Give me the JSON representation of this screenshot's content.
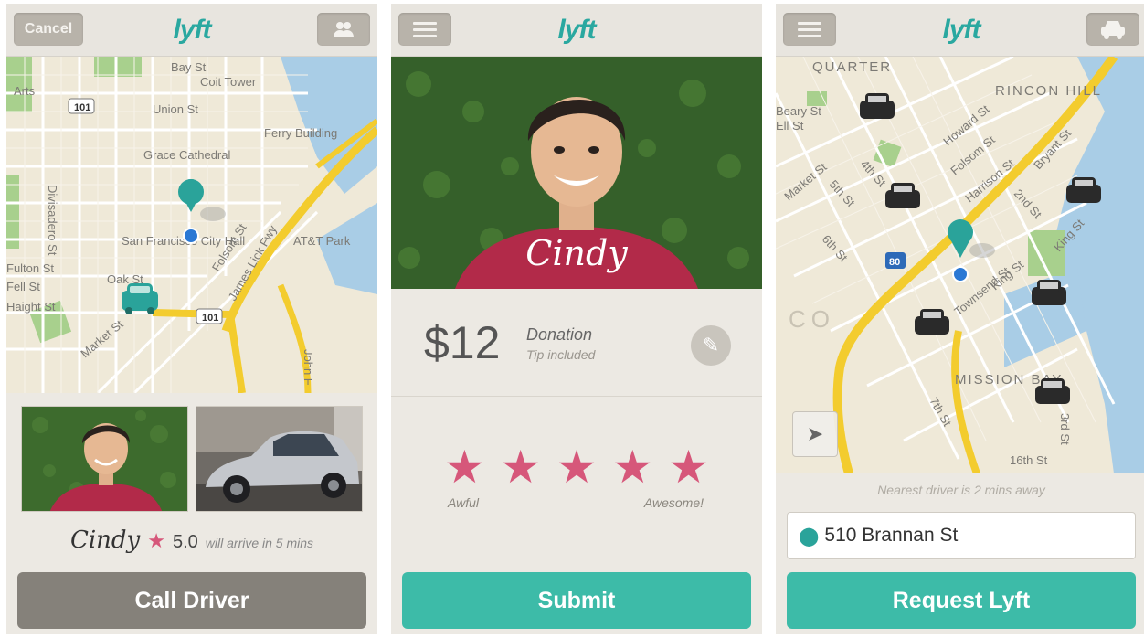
{
  "screens": {
    "pickup": {
      "nav": {
        "cancel_label": "Cancel",
        "logo": "lyft",
        "right_icon": "people-icon"
      },
      "map": {
        "labels": [
          "Bay St",
          "Coit Tower",
          "Union St",
          "Ferry Building",
          "Grace Cathedral",
          "Divisadero St",
          "San Francisco City Hall",
          "AT&T Park",
          "Folsom St",
          "James Lick Fwy",
          "Oak St",
          "Market St",
          "Fell St",
          "Haight St",
          "Fulton St",
          "101",
          "101",
          "Arts",
          "John F"
        ]
      },
      "driver": {
        "name": "Cindy",
        "rating": "5.0",
        "eta": "will arrive in 5 mins"
      },
      "call_label": "Call Driver"
    },
    "rating": {
      "nav": {
        "logo": "lyft",
        "menu_icon": "menu-icon"
      },
      "hero_name": "Cindy",
      "price": "$12",
      "price_label": "Donation",
      "price_sub": "Tip included",
      "stars_count": 5,
      "scale_low": "Awful",
      "scale_high": "Awesome!",
      "submit_label": "Submit"
    },
    "request": {
      "nav": {
        "logo": "lyft",
        "menu_icon": "menu-icon",
        "right_icon": "car-icon"
      },
      "map": {
        "labels": [
          "QUARTER",
          "RINCON HILL",
          "Howard St",
          "Folsom St",
          "Harrison St",
          "Bryant St",
          "Market St",
          "4th St",
          "5th St",
          "2nd St",
          "King St",
          "6th St",
          "Townsend St",
          "King St",
          "MISSION BAY",
          "7th St",
          "3rd St",
          "16th St",
          "80",
          "Beary St",
          "Ell St",
          "CO"
        ]
      },
      "nearest": "Nearest driver is 2 mins away",
      "address": "510 Brannan St",
      "request_label": "Request Lyft"
    }
  },
  "colors": {
    "brand_teal": "#3dbba8",
    "logo_teal": "#2aa8a0",
    "star_pink": "#d6577a",
    "button_gray": "#85817a",
    "freeway_yellow": "#f3cc2e"
  }
}
